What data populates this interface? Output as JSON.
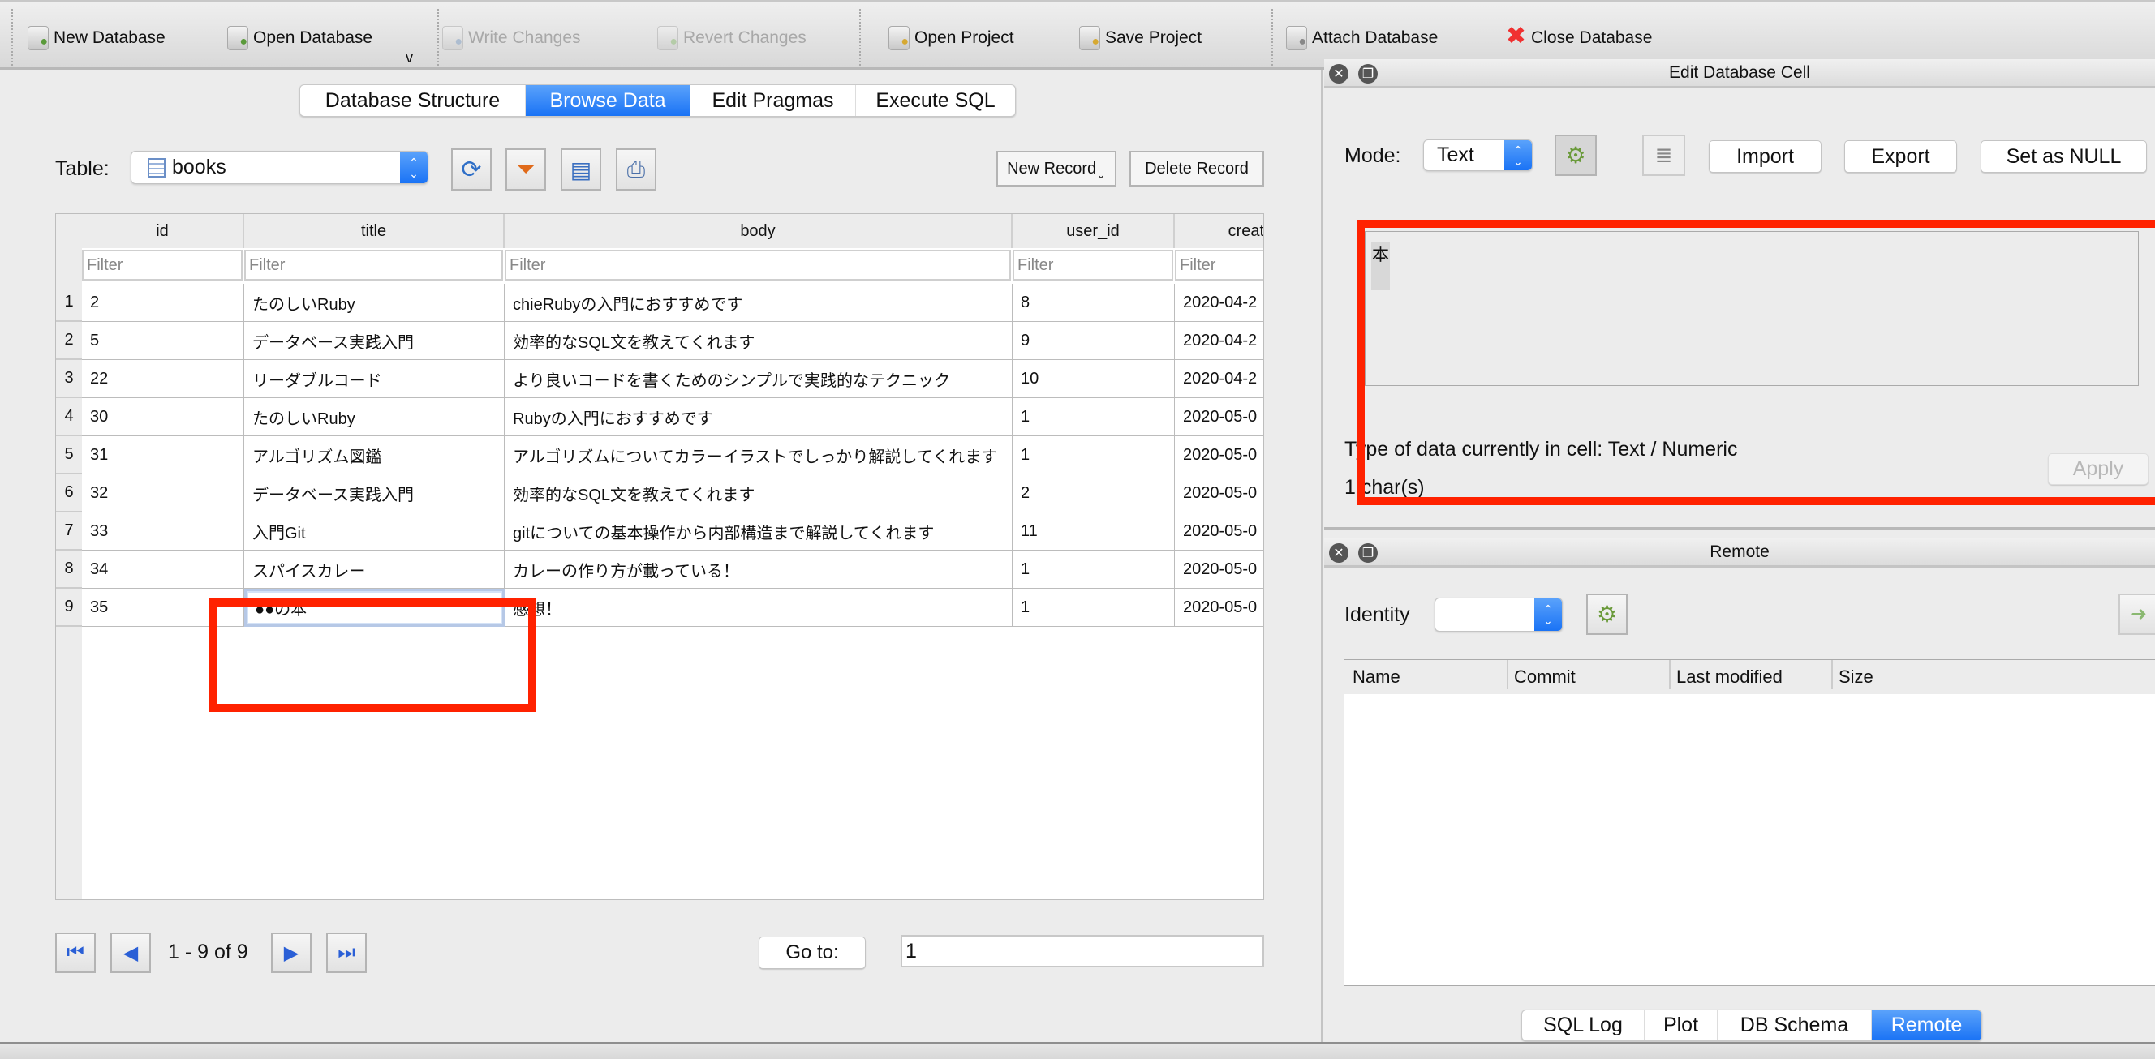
{
  "toolbar": {
    "items": [
      {
        "label": "New Database",
        "icon": "new-database-icon",
        "enabled": true
      },
      {
        "label": "Open Database",
        "icon": "open-database-icon",
        "enabled": true
      },
      {
        "label": "Write Changes",
        "icon": "write-changes-icon",
        "enabled": false
      },
      {
        "label": "Revert Changes",
        "icon": "revert-changes-icon",
        "enabled": false
      },
      {
        "label": "Open Project",
        "icon": "open-project-icon",
        "enabled": true
      },
      {
        "label": "Save Project",
        "icon": "save-project-icon",
        "enabled": true
      },
      {
        "label": "Attach Database",
        "icon": "attach-database-icon",
        "enabled": true
      },
      {
        "label": "Close Database",
        "icon": "close-database-icon",
        "enabled": true
      }
    ],
    "dropdown_glyph": "v"
  },
  "main_tabs": [
    {
      "label": "Database Structure",
      "active": false
    },
    {
      "label": "Browse Data",
      "active": true
    },
    {
      "label": "Edit Pragmas",
      "active": false
    },
    {
      "label": "Execute SQL",
      "active": false
    }
  ],
  "browse": {
    "table_label": "Table:",
    "table_value": "books",
    "new_record": "New Record",
    "delete_record": "Delete Record",
    "columns": [
      "id",
      "title",
      "body",
      "user_id",
      "created"
    ],
    "filter_placeholder": "Filter",
    "rows": [
      [
        "1",
        "2",
        "たのしいRuby",
        "chieRubyの入門におすすめです",
        "8",
        "2020-04-2"
      ],
      [
        "2",
        "5",
        "データベース実践入門",
        "効率的なSQL文を教えてくれます",
        "9",
        "2020-04-2"
      ],
      [
        "3",
        "22",
        "リーダブルコード",
        "より良いコードを書くためのシンプルで実践的なテクニック",
        "10",
        "2020-04-2"
      ],
      [
        "4",
        "30",
        "たのしいRuby",
        "Rubyの入門におすすめです",
        "1",
        "2020-05-0"
      ],
      [
        "5",
        "31",
        "アルゴリズム図鑑",
        "アルゴリズムについてカラーイラストでしっかり解説してくれます",
        "1",
        "2020-05-0"
      ],
      [
        "6",
        "32",
        "データベース実践入門",
        "効率的なSQL文を教えてくれます",
        "2",
        "2020-05-0"
      ],
      [
        "7",
        "33",
        "入門Git",
        "gitについての基本操作から内部構造まで解説してくれます",
        "11",
        "2020-05-0"
      ],
      [
        "8",
        "34",
        "スパイスカレー",
        "カレーの作り方が載っている！",
        "1",
        "2020-05-0"
      ],
      [
        "9",
        "35",
        "●●の本",
        "感想！",
        "1",
        "2020-05-0"
      ]
    ],
    "editing_cell": "●●の本",
    "pagination": "1 - 9 of 9",
    "goto_label": "Go to:",
    "goto_value": "1"
  },
  "edit_cell": {
    "title": "Edit Database Cell",
    "mode_label": "Mode:",
    "mode_value": "Text",
    "import": "Import",
    "export": "Export",
    "set_null": "Set as NULL",
    "content": "本",
    "type_info": "Type of data currently in cell: Text / Numeric",
    "char_count": "1 char(s)",
    "apply": "Apply"
  },
  "remote": {
    "title": "Remote",
    "identity_label": "Identity",
    "identity_value": "",
    "columns": [
      "Name",
      "Commit",
      "Last modified",
      "Size"
    ]
  },
  "bottom_tabs": [
    {
      "label": "SQL Log",
      "active": false
    },
    {
      "label": "Plot",
      "active": false
    },
    {
      "label": "DB Schema",
      "active": false
    },
    {
      "label": "Remote",
      "active": true
    }
  ],
  "colors": {
    "accent": "#1a73f5",
    "highlight": "#ff2200"
  }
}
